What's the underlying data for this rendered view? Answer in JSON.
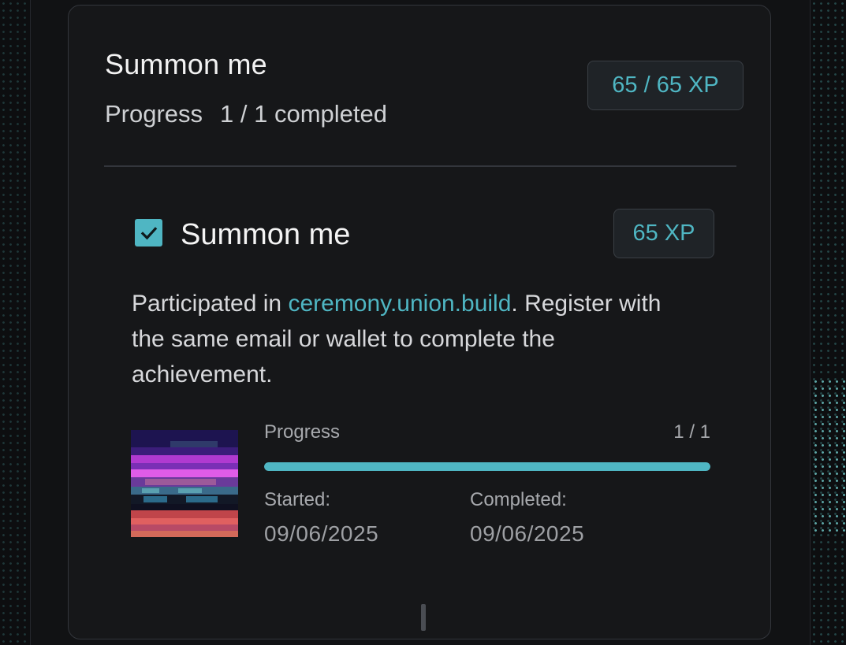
{
  "card": {
    "title": "Summon me",
    "progress_label": "Progress",
    "progress_value": "1 / 1 completed",
    "xp_total": "65 / 65 XP"
  },
  "task": {
    "checked": true,
    "title": "Summon me",
    "xp": "65 XP",
    "description_prefix": "Participated in ",
    "description_link": "ceremony.union.build",
    "description_suffix": ". Register with the same email or wallet to complete the achievement.",
    "progress_label": "Progress",
    "progress_value": "1 / 1",
    "progress_fraction": 1.0,
    "started_label": "Started:",
    "started_date": "09/06/2025",
    "completed_label": "Completed:",
    "completed_date": "09/06/2025"
  },
  "icons": {
    "checkbox": "check-icon"
  },
  "colors": {
    "accent": "#4fb6c3",
    "card_bg": "#161719",
    "text_primary": "#f2f2f2",
    "text_secondary": "#a7a9ad"
  }
}
